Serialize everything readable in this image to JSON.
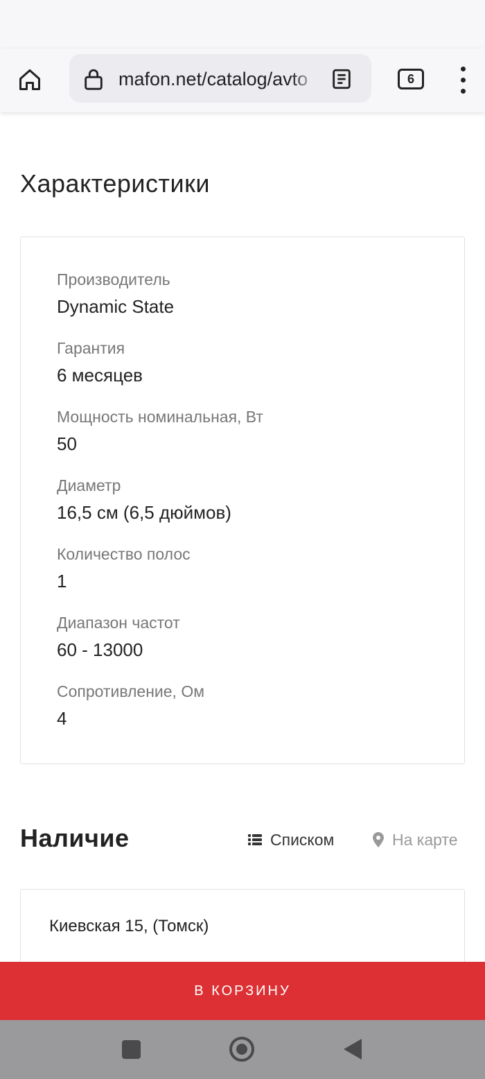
{
  "browser": {
    "url": "mafon.net/catalog/avto",
    "tab_count": "6"
  },
  "specs": {
    "heading": "Характеристики",
    "items": [
      {
        "label": "Производитель",
        "value": "Dynamic State"
      },
      {
        "label": "Гарантия",
        "value": "6 месяцев"
      },
      {
        "label": "Мощность номинальная, Вт",
        "value": "50"
      },
      {
        "label": "Диаметр",
        "value": "16,5 см (6,5 дюймов)"
      },
      {
        "label": "Количество полос",
        "value": "1"
      },
      {
        "label": "Диапазон частот",
        "value": "60 - 13000"
      },
      {
        "label": "Сопротивление, Ом",
        "value": "4"
      }
    ]
  },
  "availability": {
    "heading": "Наличие",
    "view_list_label": "Списком",
    "view_map_label": "На карте",
    "stores": [
      {
        "name": "Киевская 15, (Томск)"
      }
    ]
  },
  "cart": {
    "button_label": "В КОРЗИНУ"
  },
  "colors": {
    "accent": "#dd3034",
    "muted_text": "#777777",
    "nav_bar": "#9a9a9c"
  },
  "icons": {
    "home": "home-icon",
    "lock": "lock-icon",
    "reader": "reader-mode-icon",
    "menu": "more-vert-icon",
    "list": "list-icon",
    "map": "map-pin-icon"
  }
}
